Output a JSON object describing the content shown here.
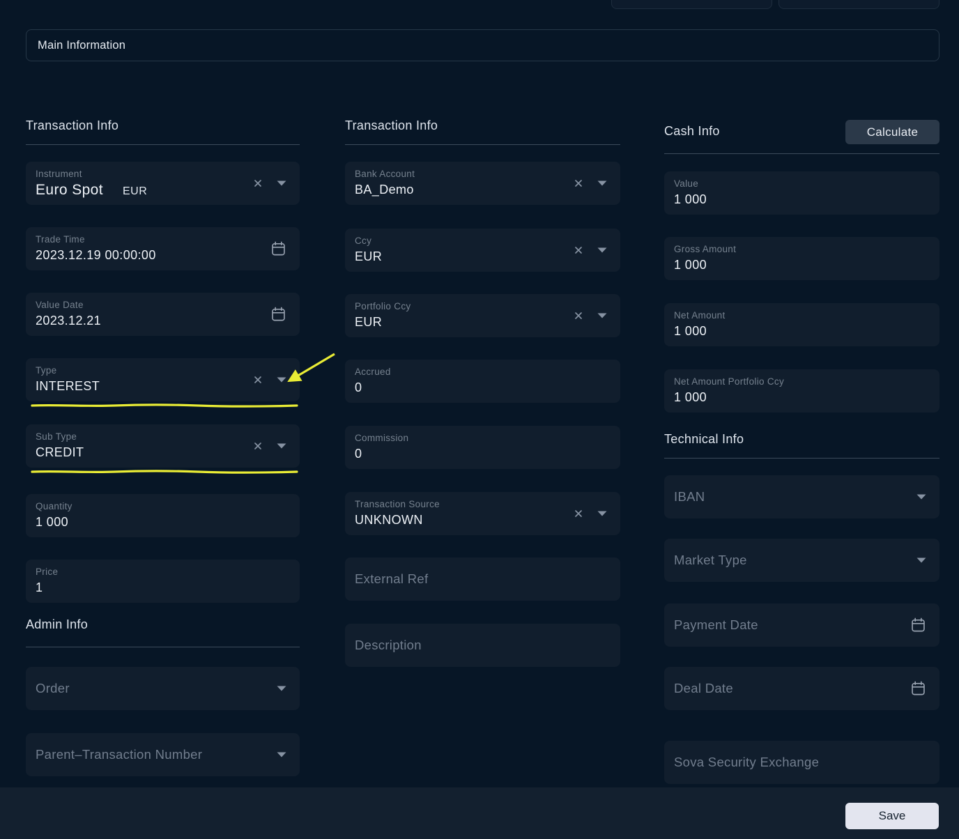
{
  "header": {
    "main_information_label": "Main Information"
  },
  "left_column": {
    "transaction_info_title": "Transaction Info",
    "instrument": {
      "label": "Instrument",
      "value": "Euro Spot",
      "currency": "EUR"
    },
    "trade_time": {
      "label": "Trade Time",
      "value": "2023.12.19 00:00:00"
    },
    "value_date": {
      "label": "Value Date",
      "value": "2023.12.21"
    },
    "type": {
      "label": "Type",
      "value": "INTEREST"
    },
    "sub_type": {
      "label": "Sub Type",
      "value": "CREDIT"
    },
    "quantity": {
      "label": "Quantity",
      "value": "1 000"
    },
    "price": {
      "label": "Price",
      "value": "1"
    },
    "admin_info_title": "Admin Info",
    "order": {
      "placeholder": "Order"
    },
    "parent_transaction_number": {
      "placeholder": "Parent–Transaction Number"
    }
  },
  "middle_column": {
    "transaction_info_title": "Transaction Info",
    "bank_account": {
      "label": "Bank Account",
      "value": "BA_Demo"
    },
    "ccy": {
      "label": "Ccy",
      "value": "EUR"
    },
    "portfolio_ccy": {
      "label": "Portfolio Ccy",
      "value": "EUR"
    },
    "accrued": {
      "label": "Accrued",
      "value": "0"
    },
    "commission": {
      "label": "Commission",
      "value": "0"
    },
    "transaction_source": {
      "label": "Transaction Source",
      "value": "UNKNOWN"
    },
    "external_ref": {
      "placeholder": "External Ref"
    },
    "description": {
      "placeholder": "Description"
    }
  },
  "right_column": {
    "cash_info_title": "Cash Info",
    "calculate_label": "Calculate",
    "value": {
      "label": "Value",
      "value": "1 000"
    },
    "gross_amount": {
      "label": "Gross Amount",
      "value": "1 000"
    },
    "net_amount": {
      "label": "Net Amount",
      "value": "1 000"
    },
    "net_amount_portfolio_ccy": {
      "label": "Net Amount Portfolio Ccy",
      "value": "1 000"
    },
    "technical_info_title": "Technical Info",
    "iban": {
      "placeholder": "IBAN"
    },
    "market_type": {
      "placeholder": "Market Type"
    },
    "payment_date": {
      "placeholder": "Payment Date"
    },
    "deal_date": {
      "placeholder": "Deal Date"
    },
    "sova_security_exchange": {
      "placeholder": "Sova Security Exchange"
    }
  },
  "footer": {
    "save_label": "Save"
  },
  "annotation": {
    "highlight_color": "#e9ec35"
  },
  "colors": {
    "page_bg": "#071626",
    "field_bg": "#111e2d",
    "footer_bg": "#13202f",
    "save_button_bg": "#e3e5ef",
    "calculate_button_bg": "#2b3949",
    "accent_highlight": "#e9ec35"
  }
}
